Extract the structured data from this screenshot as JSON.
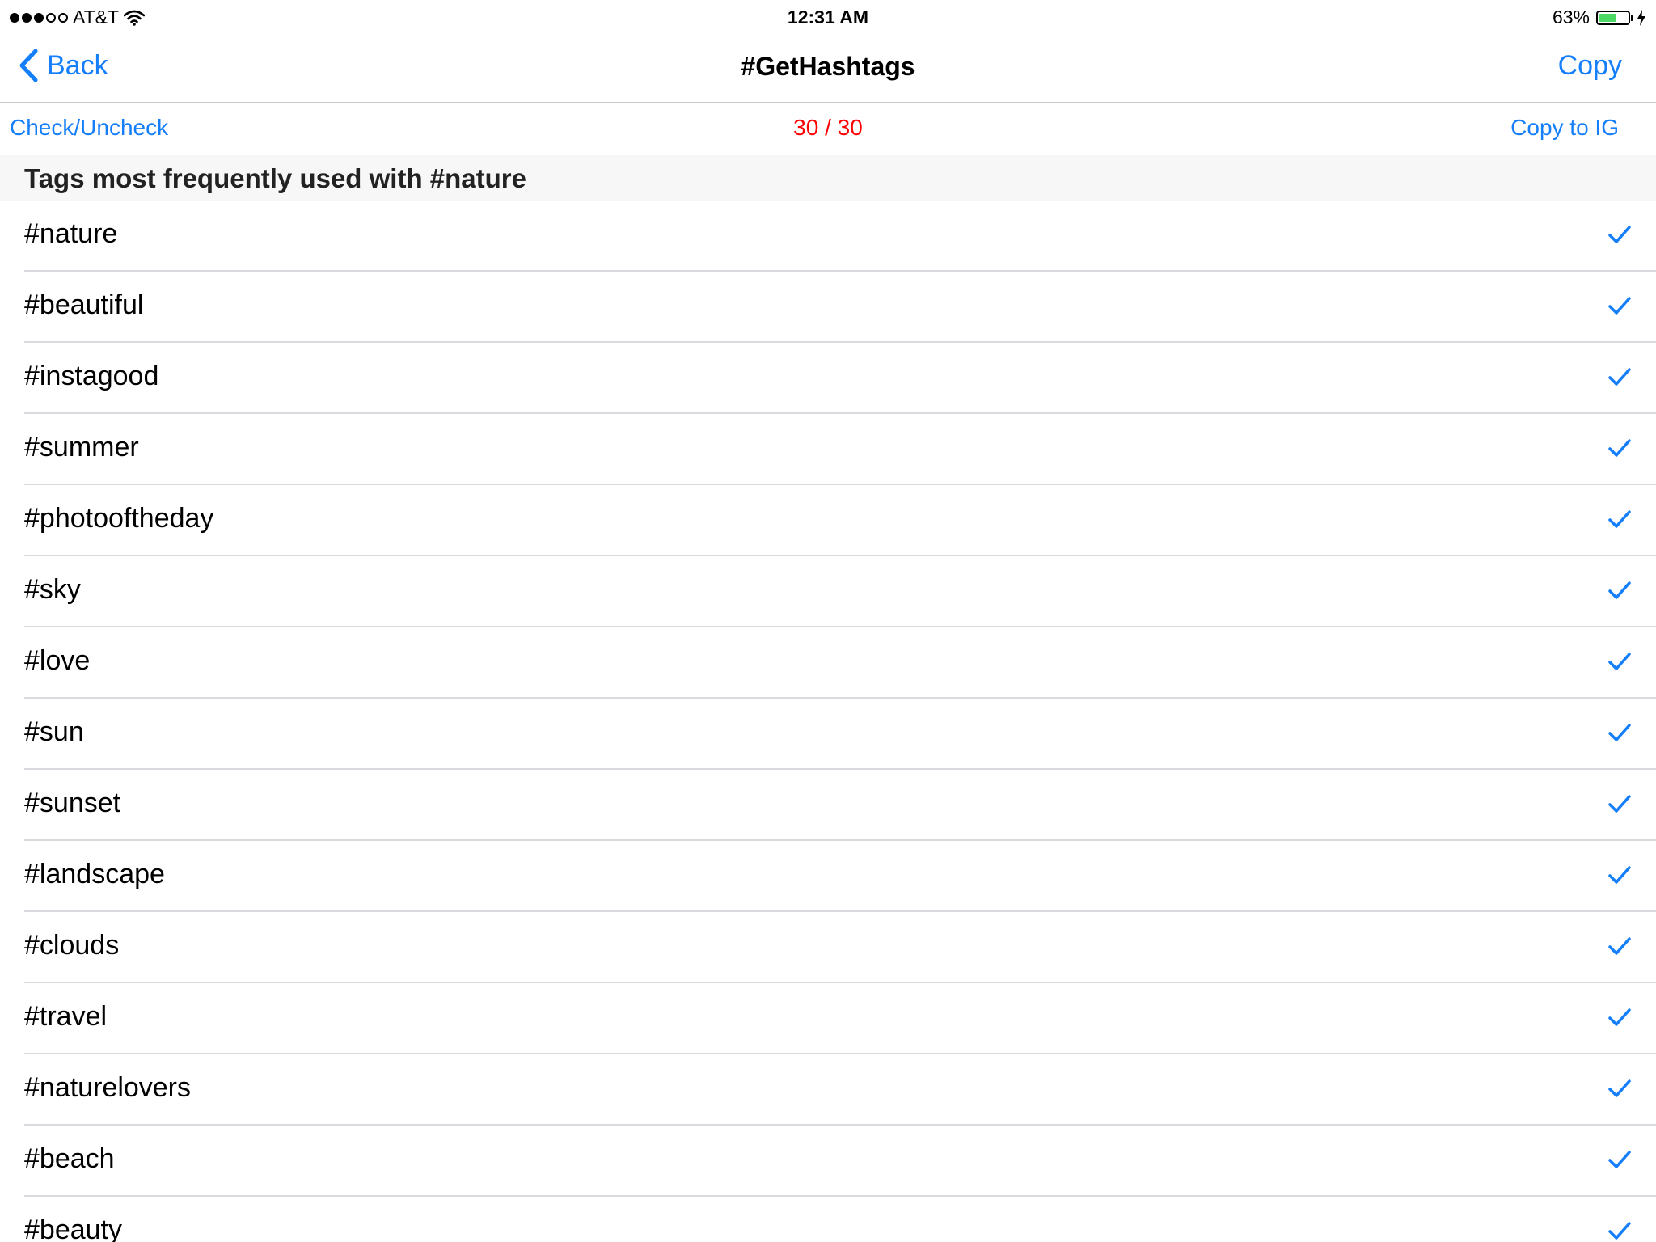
{
  "status_bar": {
    "carrier": "AT&T",
    "time": "12:31 AM",
    "battery_percent": "63%",
    "battery_level": 0.63,
    "signal_bars": 3,
    "signal_total": 5
  },
  "nav": {
    "back_label": "Back",
    "title": "#GetHashtags",
    "copy_label": "Copy"
  },
  "toolbar": {
    "check_uncheck_label": "Check/Uncheck",
    "counter": "30 / 30",
    "copy_to_ig_label": "Copy to IG"
  },
  "section": {
    "header": "Tags most frequently used with #nature"
  },
  "tags": [
    {
      "label": "#nature",
      "checked": true
    },
    {
      "label": "#beautiful",
      "checked": true
    },
    {
      "label": "#instagood",
      "checked": true
    },
    {
      "label": "#summer",
      "checked": true
    },
    {
      "label": "#photooftheday",
      "checked": true
    },
    {
      "label": "#sky",
      "checked": true
    },
    {
      "label": "#love",
      "checked": true
    },
    {
      "label": "#sun",
      "checked": true
    },
    {
      "label": "#sunset",
      "checked": true
    },
    {
      "label": "#landscape",
      "checked": true
    },
    {
      "label": "#clouds",
      "checked": true
    },
    {
      "label": "#travel",
      "checked": true
    },
    {
      "label": "#naturelovers",
      "checked": true
    },
    {
      "label": "#beach",
      "checked": true
    },
    {
      "label": "#beauty",
      "checked": true
    }
  ],
  "colors": {
    "accent": "#147efb",
    "counter": "#ff0000",
    "battery": "#4cd964"
  }
}
